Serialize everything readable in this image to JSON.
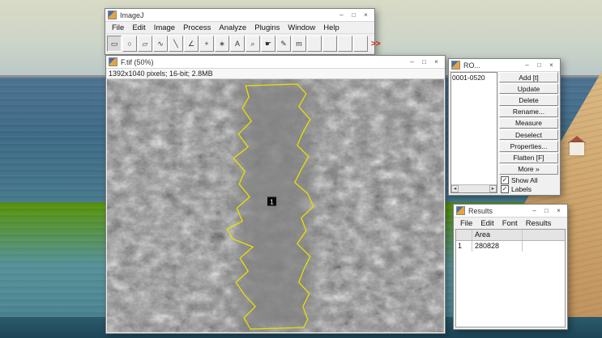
{
  "icons": {
    "minimize": "–",
    "maximize": "□",
    "close": "×",
    "check": "✓",
    "scroll_left": "◄",
    "scroll_right": "►"
  },
  "colors": {
    "roi_outline": "#e8e100",
    "more_tools_red": "#cc2200"
  },
  "imagej": {
    "title": "ImageJ",
    "menus": [
      "File",
      "Edit",
      "Image",
      "Process",
      "Analyze",
      "Plugins",
      "Window",
      "Help"
    ],
    "tools": [
      {
        "name": "rectangle-tool",
        "glyph": "▭"
      },
      {
        "name": "oval-tool",
        "glyph": "○"
      },
      {
        "name": "polygon-tool",
        "glyph": "▱"
      },
      {
        "name": "freehand-tool",
        "glyph": "∿"
      },
      {
        "name": "line-tool",
        "glyph": "╲"
      },
      {
        "name": "angle-tool",
        "glyph": "∠"
      },
      {
        "name": "point-tool",
        "glyph": "+"
      },
      {
        "name": "wand-tool",
        "glyph": "∗"
      },
      {
        "name": "text-tool",
        "glyph": "A"
      },
      {
        "name": "zoom-tool",
        "glyph": "⌕"
      },
      {
        "name": "hand-tool",
        "glyph": "☛"
      },
      {
        "name": "color-picker-tool",
        "glyph": "✎"
      },
      {
        "name": "macro-tool",
        "glyph": "m"
      }
    ],
    "more_tools_label": ">>"
  },
  "image_window": {
    "title": "F.tif (50%)",
    "status": "1392x1040 pixels; 16-bit; 2.8MB",
    "roi_label": "1"
  },
  "roi_manager": {
    "title": "RO...",
    "items": [
      "0001-0520"
    ],
    "buttons": [
      "Add [t]",
      "Update",
      "Delete",
      "Rename...",
      "Measure",
      "Deselect",
      "Properties...",
      "Flatten [F]",
      "More »"
    ],
    "checkboxes": [
      {
        "label": "Show All",
        "checked": true
      },
      {
        "label": "Labels",
        "checked": true
      }
    ]
  },
  "results": {
    "title": "Results",
    "menus": [
      "File",
      "Edit",
      "Font",
      "Results"
    ],
    "columns": [
      "",
      "Area"
    ],
    "rows": [
      {
        "id": "1",
        "area": "280828"
      }
    ]
  }
}
